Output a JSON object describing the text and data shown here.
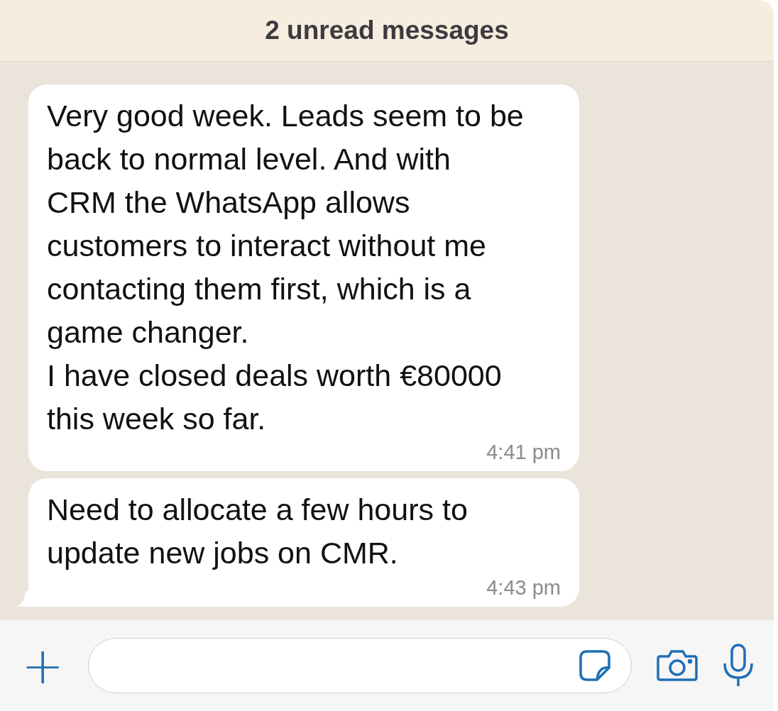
{
  "banner": {
    "text": "2 unread messages"
  },
  "messages": [
    {
      "text": "Very good week. Leads seem to be back to normal level. And with CRM the WhatsApp allows customers to interact without me contacting them first, which is a game changer.\nI have closed deals worth €80000 this week so far.",
      "time": "4:41 pm",
      "tail": false
    },
    {
      "text": "Need to allocate a few hours to update new jobs on CMR.",
      "time": "4:43 pm",
      "tail": true
    }
  ],
  "composer": {
    "attach": "+"
  }
}
